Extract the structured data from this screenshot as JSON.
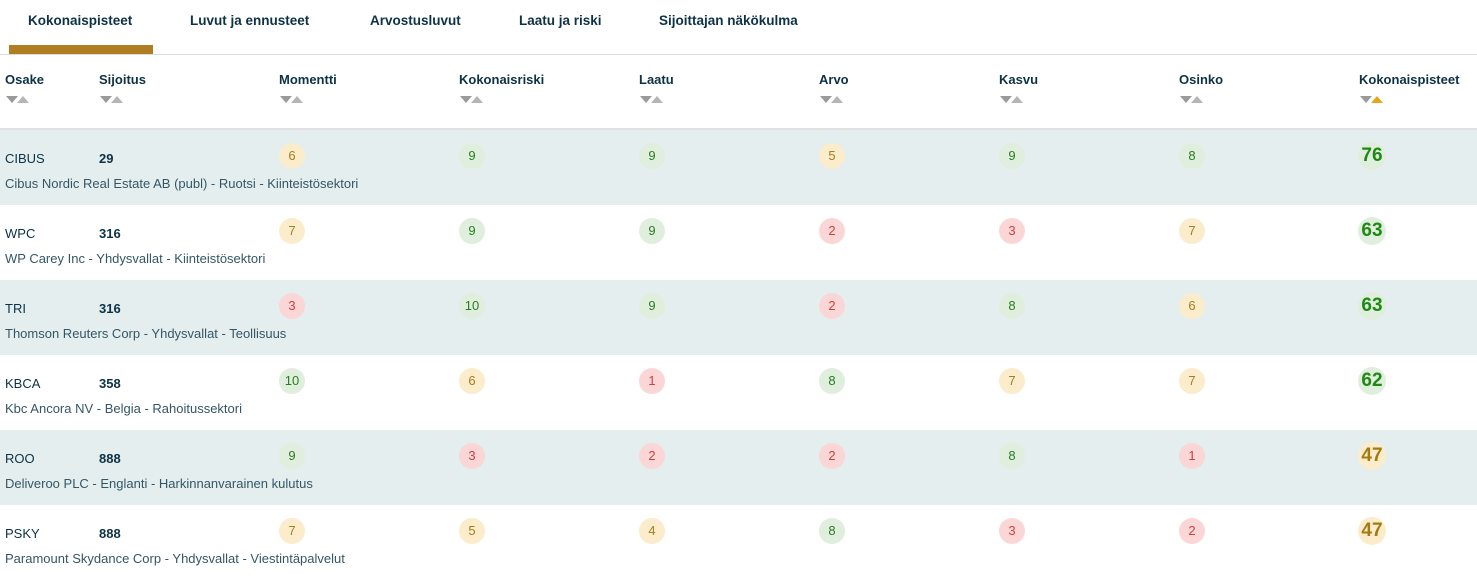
{
  "tabs": [
    {
      "label": "Kokonaispisteet",
      "active": true
    },
    {
      "label": "Luvut ja ennusteet",
      "active": false
    },
    {
      "label": "Arvostusluvut",
      "active": false
    },
    {
      "label": "Laatu ja riski",
      "active": false
    },
    {
      "label": "Sijoittajan näkökulma",
      "active": false
    }
  ],
  "columns": [
    "Osake",
    "Sijoitus",
    "Momentti",
    "Kokonaisriski",
    "Laatu",
    "Arvo",
    "Kasvu",
    "Osinko",
    "Kokonaispisteet"
  ],
  "sort": {
    "column": "Kokonaispisteet",
    "direction": "ascending-arrow-active",
    "active_color": "#e7a517"
  },
  "colors": {
    "good": "#2a7d1f",
    "mid": "#a67c1e",
    "bad": "#d04040",
    "accent": "#b07d22",
    "row_alt": "#e4eeee"
  },
  "rows": [
    {
      "ticker": "CIBUS",
      "rank": "29",
      "desc": "Cibus Nordic Real Estate AB (publ) - Ruotsi - Kiinteistösektori",
      "scores": [
        {
          "v": "6",
          "c": "mid"
        },
        {
          "v": "9",
          "c": "good"
        },
        {
          "v": "9",
          "c": "good"
        },
        {
          "v": "5",
          "c": "mid"
        },
        {
          "v": "9",
          "c": "good"
        },
        {
          "v": "8",
          "c": "good"
        }
      ],
      "total": {
        "v": "76",
        "c": "good"
      }
    },
    {
      "ticker": "WPC",
      "rank": "316",
      "desc": "WP Carey Inc - Yhdysvallat - Kiinteistösektori",
      "scores": [
        {
          "v": "7",
          "c": "mid"
        },
        {
          "v": "9",
          "c": "good"
        },
        {
          "v": "9",
          "c": "good"
        },
        {
          "v": "2",
          "c": "bad"
        },
        {
          "v": "3",
          "c": "bad"
        },
        {
          "v": "7",
          "c": "mid"
        }
      ],
      "total": {
        "v": "63",
        "c": "good"
      }
    },
    {
      "ticker": "TRI",
      "rank": "316",
      "desc": "Thomson Reuters Corp - Yhdysvallat - Teollisuus",
      "scores": [
        {
          "v": "3",
          "c": "bad"
        },
        {
          "v": "10",
          "c": "good"
        },
        {
          "v": "9",
          "c": "good"
        },
        {
          "v": "2",
          "c": "bad"
        },
        {
          "v": "8",
          "c": "good"
        },
        {
          "v": "6",
          "c": "mid"
        }
      ],
      "total": {
        "v": "63",
        "c": "good"
      }
    },
    {
      "ticker": "KBCA",
      "rank": "358",
      "desc": "Kbc Ancora NV - Belgia - Rahoitussektori",
      "scores": [
        {
          "v": "10",
          "c": "good"
        },
        {
          "v": "6",
          "c": "mid"
        },
        {
          "v": "1",
          "c": "bad"
        },
        {
          "v": "8",
          "c": "good"
        },
        {
          "v": "7",
          "c": "mid"
        },
        {
          "v": "7",
          "c": "mid"
        }
      ],
      "total": {
        "v": "62",
        "c": "good"
      }
    },
    {
      "ticker": "ROO",
      "rank": "888",
      "desc": "Deliveroo PLC - Englanti - Harkinnanvarainen kulutus",
      "scores": [
        {
          "v": "9",
          "c": "good"
        },
        {
          "v": "3",
          "c": "bad"
        },
        {
          "v": "2",
          "c": "bad"
        },
        {
          "v": "2",
          "c": "bad"
        },
        {
          "v": "8",
          "c": "good"
        },
        {
          "v": "1",
          "c": "bad"
        }
      ],
      "total": {
        "v": "47",
        "c": "mid"
      }
    },
    {
      "ticker": "PSKY",
      "rank": "888",
      "desc": "Paramount Skydance Corp - Yhdysvallat - Viestintäpalvelut",
      "scores": [
        {
          "v": "7",
          "c": "mid"
        },
        {
          "v": "5",
          "c": "mid"
        },
        {
          "v": "4",
          "c": "mid"
        },
        {
          "v": "8",
          "c": "good"
        },
        {
          "v": "3",
          "c": "bad"
        },
        {
          "v": "2",
          "c": "bad"
        }
      ],
      "total": {
        "v": "47",
        "c": "mid"
      }
    }
  ]
}
